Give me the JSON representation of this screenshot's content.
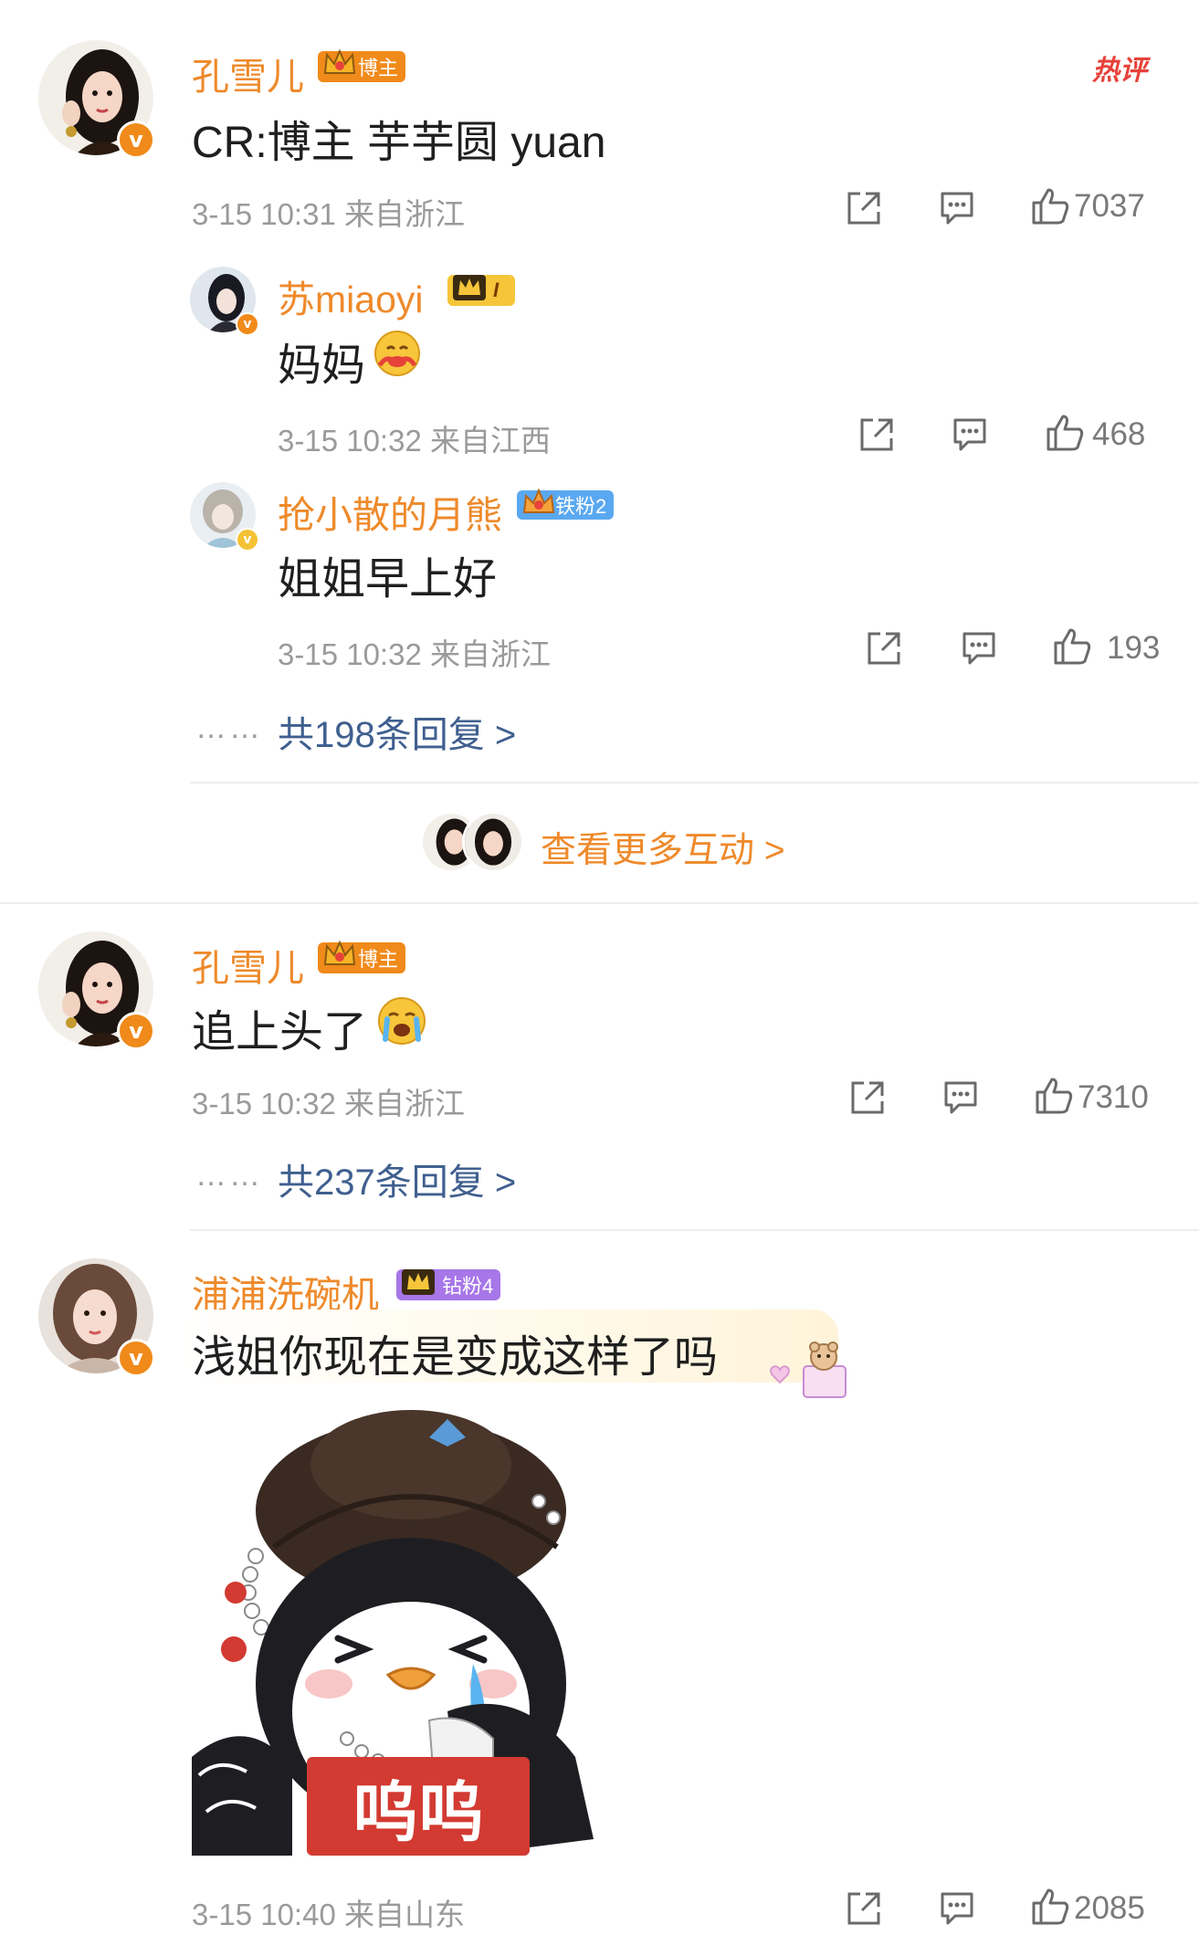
{
  "comments": [
    {
      "author": "孔雪儿",
      "badge": "博主",
      "badge_color": "#f08a1a",
      "text": "CR:博主 芋芋圆 yuan",
      "meta": "3-15 10:31  来自浙江",
      "likes": "7037",
      "hot_tag": "热评",
      "replies": [
        {
          "author": "苏miaoyi",
          "badge": "I",
          "text": "妈妈",
          "emoji": "hug-face-emoji",
          "meta": "3-15 10:32  来自江西",
          "likes": "468"
        },
        {
          "author": "抢小散的月熊",
          "badge": "铁粉2",
          "text": "姐姐早上好",
          "meta": "3-15 10:32  来自浙江",
          "likes": "193"
        }
      ],
      "replies_dots": "……",
      "replies_link": "共198条回复 >"
    },
    {
      "author": "孔雪儿",
      "badge": "博主",
      "text": "追上头了",
      "emoji": "crying-face-emoji",
      "meta": "3-15 10:32  来自浙江",
      "likes": "7310",
      "replies_dots": "……",
      "replies_link": "共237条回复 >"
    },
    {
      "author": "浦浦洗碗机",
      "badge": "钻粉4",
      "badge_color": "#a776e8",
      "text": "浅姐你现在是变成这样了吗",
      "sticker_text": "呜呜",
      "meta": "3-15 10:40  来自山东",
      "likes": "2085"
    }
  ],
  "more_interactions": "查看更多互动 >",
  "accent_color": "#ee8a2b",
  "link_color": "#3f5f8f"
}
